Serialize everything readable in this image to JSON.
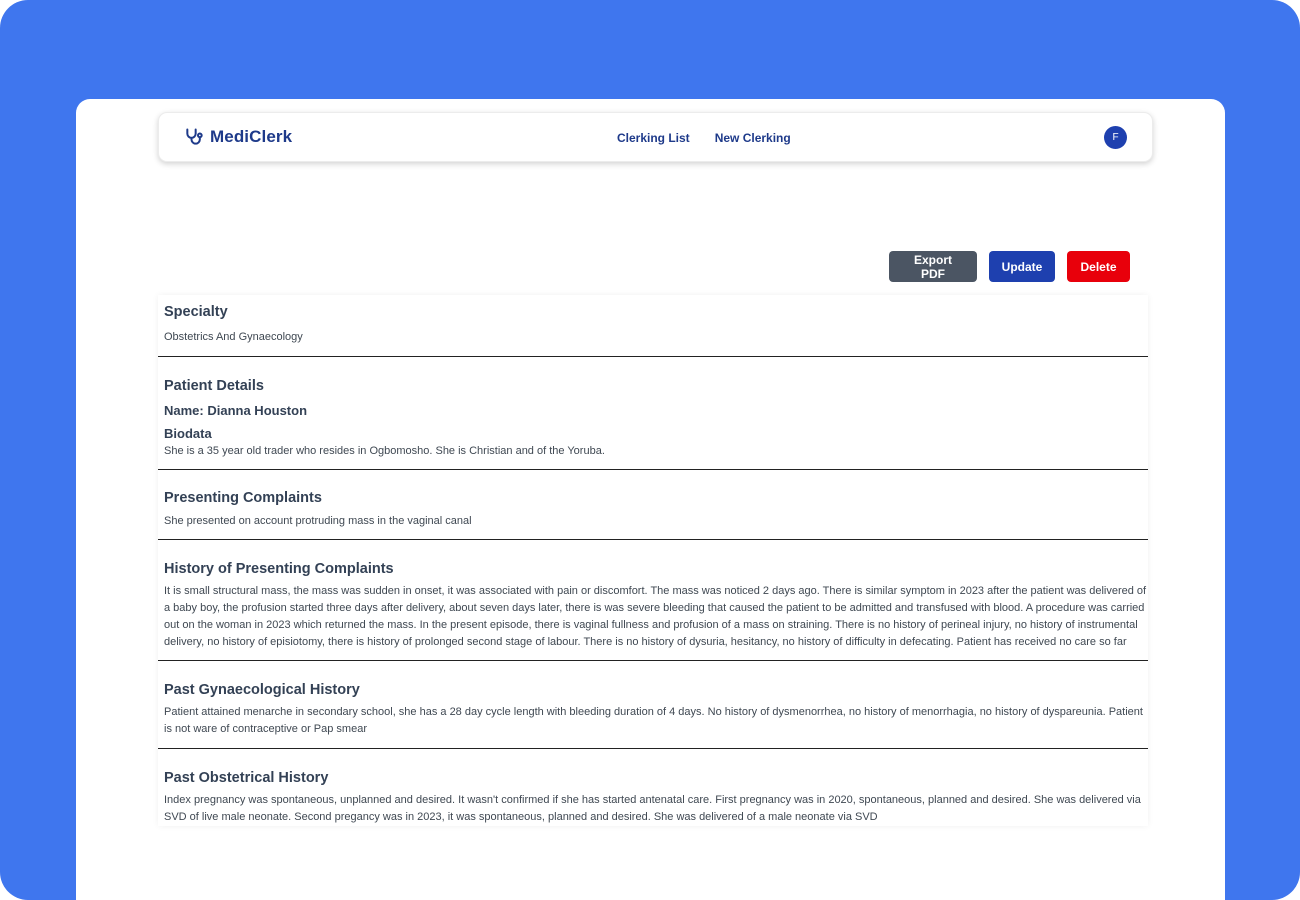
{
  "nav": {
    "brand": "MediClerk",
    "links": [
      "Clerking List",
      "New Clerking"
    ],
    "avatar_initial": "F"
  },
  "actions": {
    "export_label": "Export PDF",
    "update_label": "Update",
    "delete_label": "Delete"
  },
  "sections": {
    "specialty": {
      "title": "Specialty",
      "text": "Obstetrics And Gynaecology"
    },
    "patient": {
      "title": "Patient Details",
      "name": "Name: Dianna Houston",
      "biodata_title": "Biodata",
      "biodata": "She is a 35 year old trader who resides in Ogbomosho. She is Christian and of the Yoruba."
    },
    "complaints": {
      "title": "Presenting Complaints",
      "text": "She presented on account protruding mass in the vaginal canal"
    },
    "hpc": {
      "title": "History of Presenting Complaints",
      "text": "It is small structural mass, the mass was sudden in onset, it was associated with pain or discomfort. The mass was noticed 2 days ago. There is similar symptom in 2023 after the patient was delivered of a baby boy, the profusion started three days after delivery, about seven days later, there is was severe bleeding that caused the patient to be admitted and transfused with blood. A procedure was carried out on the woman in 2023 which returned the mass. In the present episode, there is vaginal fullness and profusion of a mass on straining. There is no history of perineal injury, no history of instrumental delivery, no history of episiotomy, there is history of prolonged second stage of labour. There is no history of dysuria, hesitancy, no history of difficulty in defecating. Patient has received no care so far"
    },
    "gyn": {
      "title": "Past Gynaecological History",
      "text": "Patient attained menarche in secondary school, she has a 28 day cycle length with bleeding duration of 4 days. No history of dysmenorrhea, no history of menorrhagia, no history of dyspareunia. Patient is not ware of contraceptive or Pap smear"
    },
    "obs": {
      "title": "Past Obstetrical History",
      "text": "Index pregnancy was spontaneous, unplanned and desired. It wasn't confirmed if she has started antenatal care. First pregnancy was in 2020, spontaneous, planned and desired. She was delivered via SVD of live male neonate. Second pregancy was in 2023, it was spontaneous, planned and desired. She was delivered of a male neonate via SVD"
    }
  },
  "colors": {
    "frame_bg": "#3f76ee",
    "brand": "#1e3a8a",
    "export_btn": "#4b5563",
    "update_btn": "#1e40af",
    "delete_btn": "#e8000b"
  },
  "icons": {
    "brand": "stethoscope-icon"
  }
}
